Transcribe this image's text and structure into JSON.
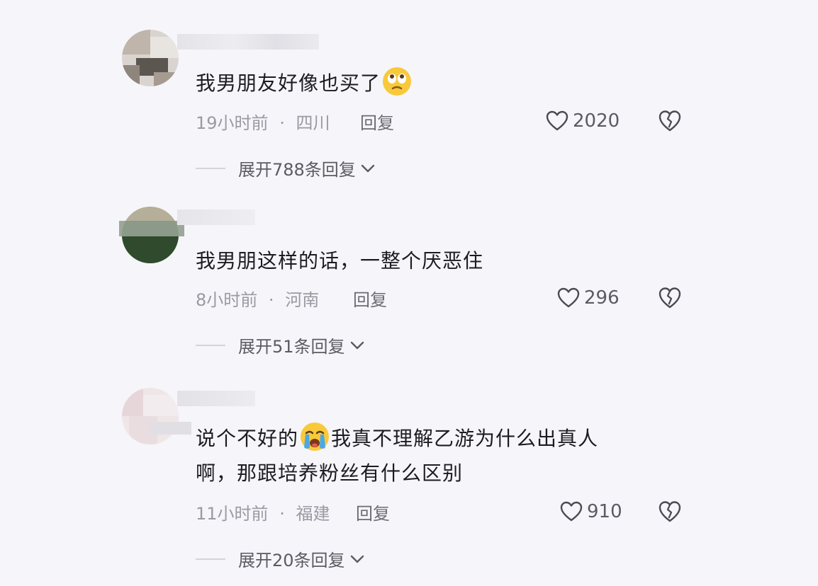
{
  "comments": [
    {
      "text": "我男朋友好像也买了",
      "emoji": "rolling-eyes-emoji",
      "time": "19小时前",
      "location": "四川",
      "reply_label": "回复",
      "likes": "2020",
      "expand_label": "展开788条回复"
    },
    {
      "text": "我男朋这样的话，一整个厌恶住",
      "time": "8小时前",
      "location": "河南",
      "reply_label": "回复",
      "likes": "296",
      "expand_label": "展开51条回复"
    },
    {
      "text_part1": "说个不好的",
      "emoji": "crying-face-emoji",
      "text_part2": "我真不理解乙游为什么出真人",
      "text_line2": "啊，那跟培养粉丝有什么区别",
      "time": "11小时前",
      "location": "福建",
      "reply_label": "回复",
      "likes": "910",
      "expand_label": "展开20条回复"
    }
  ],
  "meta_separator": "·",
  "icons": {
    "like": "heart-icon",
    "dislike": "broken-heart-icon",
    "expand": "chevron-down-icon"
  },
  "colors": {
    "background": "#f6f5f9",
    "text": "#1c1c22",
    "meta": "#9a9aa3"
  }
}
